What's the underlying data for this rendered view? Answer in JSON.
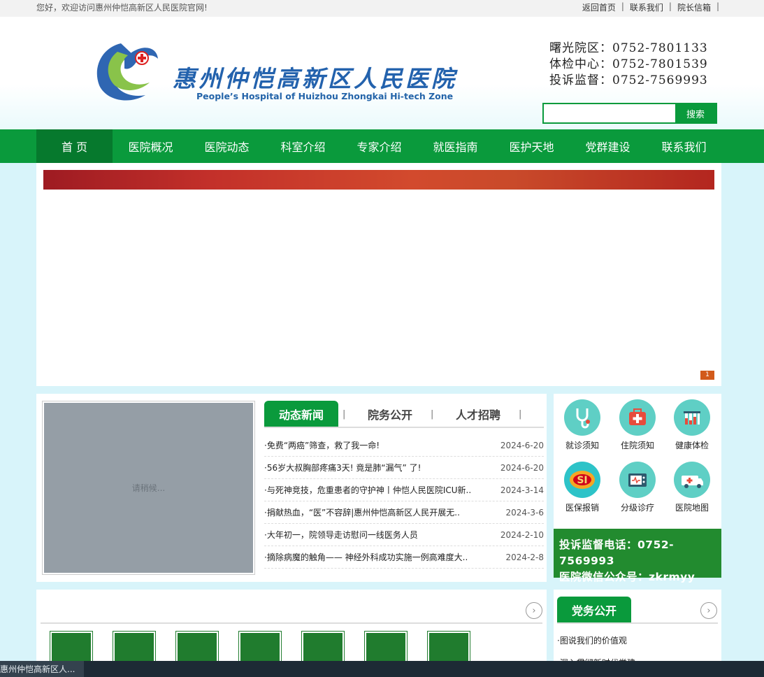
{
  "topbar": {
    "welcome": "您好，欢迎访问惠州仲恺高新区人民医院官网!",
    "links": [
      "返回首页",
      "联系我们",
      "院长信箱"
    ]
  },
  "header": {
    "logo_cn": "惠州仲恺高新区人民医院",
    "logo_en": "People’s Hospital of Huizhou Zhongkai Hi-tech Zone",
    "phones": [
      "曙光院区：0752-7801133",
      "体检中心：0752-7801539",
      "投诉监督：0752-7569993"
    ],
    "search_button": "搜索",
    "search_placeholder": ""
  },
  "nav": [
    "首 页",
    "医院概况",
    "医院动态",
    "科室介绍",
    "专家介绍",
    "就医指南",
    "医护天地",
    "党群建设",
    "联系我们"
  ],
  "banner": {
    "page_indicator": "1"
  },
  "news": {
    "photo_loading": "请稍候...",
    "tabs": [
      "动态新闻",
      "院务公开",
      "人才招聘"
    ],
    "separator": "|",
    "items": [
      {
        "title": "·免费“两癌”筛查，救了我一命!",
        "date": "2024-6-20"
      },
      {
        "title": "·56岁大叔胸部疼痛3天! 竟是肺“漏气” 了!",
        "date": "2024-6-20"
      },
      {
        "title": "·与死神竞技，危重患者的守护神丨仲恺人民医院ICU新..",
        "date": "2024-3-14"
      },
      {
        "title": "·捐献热血，“医”不容辞|惠州仲恺高新区人民开展无..",
        "date": "2024-3-6"
      },
      {
        "title": "·大年初一，院领导走访慰问一线医务人员",
        "date": "2024-2-10"
      },
      {
        "title": "·摘除病魔的触角—— 神经外科成功实施一例高难度大..",
        "date": "2024-2-8"
      }
    ]
  },
  "services": [
    "就诊须知",
    "住院须知",
    "健康体检",
    "医保报销",
    "分级诊疗",
    "医院地图"
  ],
  "hotline": {
    "complaint": "投诉监督电话：0752-7569993",
    "wechat": "医院微信公众号：zkrmyy"
  },
  "party": {
    "title": "党务公开",
    "items": [
      "·图说我们的价值观",
      "·深入贯彻新时代党建"
    ]
  },
  "taskbar": {
    "tab_title": "惠州仲恺高新区人..."
  },
  "colors": {
    "brand_green": "#0a9a3c",
    "nav_active": "#06792d",
    "hotline_bg": "#228b2f",
    "page_bg": "#d8f4fa"
  }
}
